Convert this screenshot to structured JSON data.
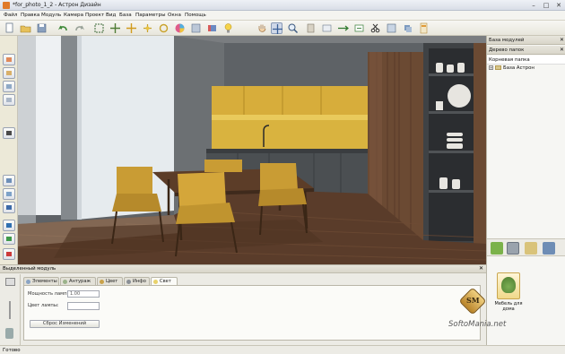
{
  "window": {
    "title": "*for_photo_1_2 - Астрон Дизайн"
  },
  "menu": [
    "Файл",
    "Правка",
    "Модуль",
    "Камера",
    "Проект",
    "Вид",
    "База",
    "Параметры",
    "Окна",
    "Помощь"
  ],
  "toolbar_icons": [
    "new-icon",
    "open-icon",
    "save-icon",
    "undo-icon",
    "redo-icon",
    "select-icon",
    "move-icon",
    "move-axis-icon",
    "rotate-icon",
    "refresh-icon",
    "color-wheel-icon",
    "render-icon",
    "palette-icon",
    "light-bulb-icon",
    "hand-icon",
    "pan-icon",
    "zoom-icon",
    "module-icon",
    "measure-icon",
    "door-icon",
    "export-icon",
    "scissors-icon",
    "floorplan-icon",
    "layers-icon",
    "report-icon"
  ],
  "right_panel": {
    "modules_header": "База модулей",
    "tree_header": "Дерево папок",
    "root_header": "Корневая папка",
    "tree_root_label": "База Астрон",
    "library_item_label": "Мебель для дома"
  },
  "bottom_panel": {
    "header": "Выделенный модуль",
    "tabs": [
      "Элементы",
      "Антураж",
      "Цвет",
      "Инфо",
      "Свет"
    ],
    "active_tab": "Свет",
    "lamp_power_label": "Мощность лампы:",
    "lamp_power_value": "1.00",
    "lamp_color_label": "Цвет лампы:",
    "reset_button": "Сброс Изменений"
  },
  "status": {
    "text": "Готово"
  },
  "watermark": {
    "badge": "SM",
    "text": "SoftoMania.net"
  },
  "colors": {
    "accent_yellow": "#d7ad3b",
    "wall_gray": "#6c6f72",
    "wood": "#6b4a33"
  }
}
